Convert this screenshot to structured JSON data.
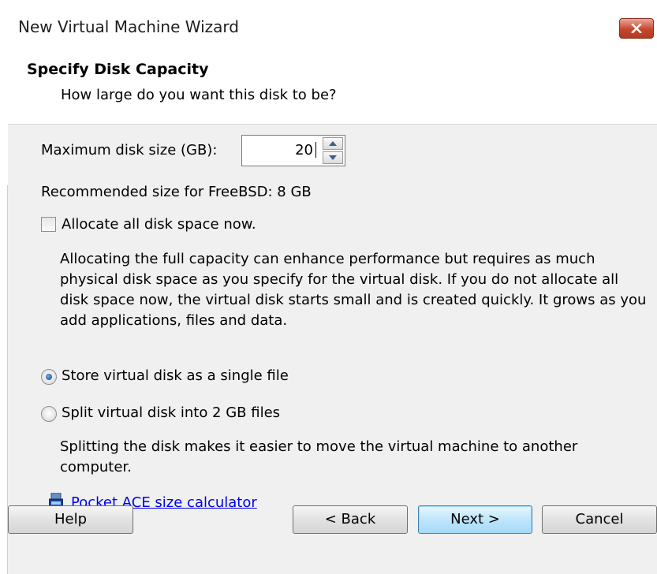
{
  "window": {
    "title": "New Virtual Machine Wizard"
  },
  "header": {
    "title": "Specify Disk Capacity",
    "subtitle": "How large do you want this disk to be?"
  },
  "disk_size": {
    "label": "Maximum disk size (GB):",
    "value": "20"
  },
  "recommended": "Recommended size for FreeBSD: 8 GB",
  "allocate": {
    "label": "Allocate all disk space now.",
    "checked": false,
    "description": "Allocating the full capacity can enhance performance but requires as much physical disk space as you specify for the virtual disk. If you do not allocate all disk space now, the virtual disk starts small and is created quickly. It grows as you add applications, files and data."
  },
  "storage_options": [
    {
      "label": "Store virtual disk as a single file",
      "selected": true
    },
    {
      "label": "Split virtual disk into 2 GB files",
      "selected": false
    }
  ],
  "split_description": "Splitting the disk makes it easier to move the virtual machine to another computer.",
  "calculator_link": "Pocket ACE size calculator",
  "buttons": {
    "help": "Help",
    "back": "< Back",
    "next": "Next >",
    "cancel": "Cancel"
  },
  "colors": {
    "accent": "#3c7fb1",
    "close": "#c5472c",
    "link": "#0000ee"
  }
}
